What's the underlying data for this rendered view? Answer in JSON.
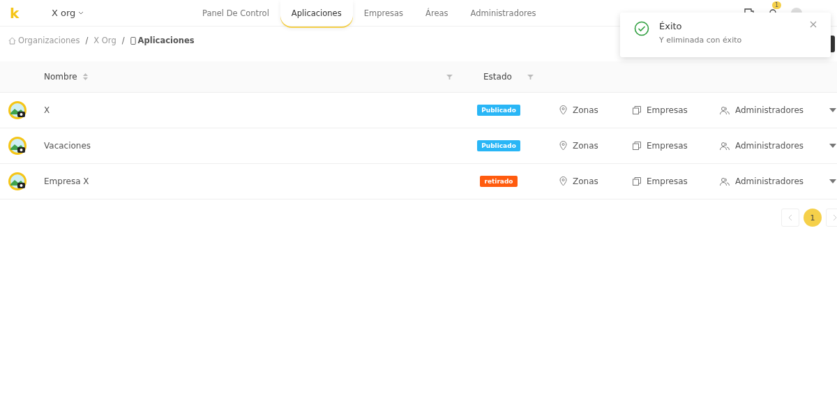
{
  "header": {
    "logo": "k",
    "org": "X org",
    "nav": [
      {
        "label": "Panel De Control",
        "selected": false
      },
      {
        "label": "Aplicaciones",
        "selected": true
      },
      {
        "label": "Empresas",
        "selected": false
      },
      {
        "label": "Áreas",
        "selected": false
      },
      {
        "label": "Administradores",
        "selected": false
      }
    ],
    "notification_count": "1"
  },
  "breadcrumb": [
    {
      "label": "Organizaciones",
      "current": false
    },
    {
      "separator": "/",
      "label": "X Org",
      "current": false
    },
    {
      "separator": "/",
      "label": "Aplicaciones",
      "current": true
    }
  ],
  "table": {
    "columns": [
      "Nombre",
      "Estado"
    ],
    "rows": [
      {
        "name": "X",
        "status": "Publicado",
        "color": "#29b6f6",
        "zones": "Zonas",
        "companies": "Empresas",
        "admins": "Administradores"
      },
      {
        "name": "Vacaciones",
        "status": "Publicado",
        "color": "#29b6f6",
        "zones": "Zonas",
        "companies": "Empresas",
        "admins": "Administradores"
      },
      {
        "name": "Empresa X",
        "status": "retirado",
        "color": "#ff5b0e",
        "zones": "Zonas",
        "companies": "Empresas",
        "admins": "Administradores"
      }
    ]
  },
  "pagination": {
    "pages": [
      {
        "label": "1",
        "selected": true
      }
    ]
  },
  "toast": {
    "title": "Éxito",
    "message": "Y eliminada con éxito"
  }
}
